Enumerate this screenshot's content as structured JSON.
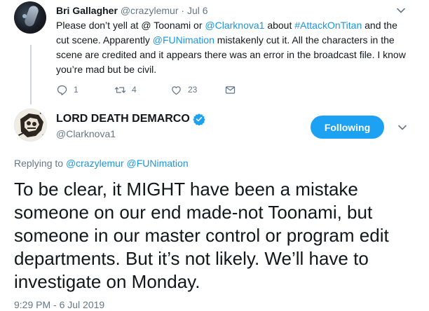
{
  "reply_tweet": {
    "author_name": "Bri Gallagher",
    "author_handle": "@crazylemur",
    "separator": "·",
    "date": "Jul 6",
    "text_parts": [
      {
        "text": "Please don’t yell at @ Toonami or ",
        "link": false
      },
      {
        "text": "@Clarknova1",
        "link": true
      },
      {
        "text": " about ",
        "link": false
      },
      {
        "text": "#AttackOnTitan",
        "link": true
      },
      {
        "text": " and the cut scene. Apparently ",
        "link": false
      },
      {
        "text": "@FUNimation",
        "link": true
      },
      {
        "text": " mistakenly cut it. All the characters in the scene are credited and it appears there was an error in the broadcast file. I know you’re mad but be civil.",
        "link": false
      }
    ],
    "reply_count": "1",
    "retweet_count": "4",
    "like_count": "23"
  },
  "main_tweet": {
    "author_name": "LORD DEATH DEMARCO",
    "author_handle": "@Clarknova1",
    "follow_label": "Following",
    "replying_prefix": "Replying to",
    "replying_to_1": "@crazylemur",
    "replying_to_2": "@FUNimation",
    "text": "To be clear, it MIGHT have been a mistake someone on our end made-not Toonami, but someone in our master control or program edit departments. But it’s not likely. We’ll have to investigate on Monday.",
    "timestamp": "9:29 PM - 6 Jul 2019"
  },
  "colors": {
    "link": "#1b95e0",
    "follow_button": "#1da1f2",
    "muted": "#657786",
    "verified": "#1da1f2"
  },
  "icons": [
    "chevron-down-icon",
    "reply-icon",
    "retweet-icon",
    "like-icon",
    "dm-icon",
    "verified-badge-icon"
  ]
}
